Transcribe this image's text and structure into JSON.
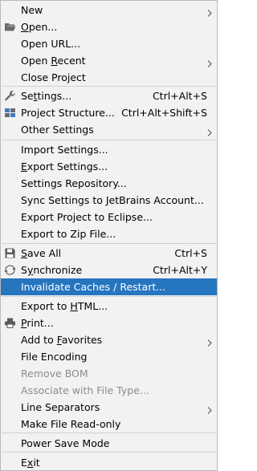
{
  "menu": {
    "items": [
      {
        "id": "new",
        "label": "New",
        "mnemonic_index": -1,
        "shortcut": "",
        "submenu": true,
        "icon": "",
        "disabled": false
      },
      {
        "id": "open",
        "label": "Open...",
        "mnemonic_index": 0,
        "shortcut": "",
        "submenu": false,
        "icon": "folder-open-icon",
        "disabled": false
      },
      {
        "id": "open-url",
        "label": "Open URL...",
        "mnemonic_index": -1,
        "shortcut": "",
        "submenu": false,
        "icon": "",
        "disabled": false
      },
      {
        "id": "open-recent",
        "label": "Open Recent",
        "mnemonic_index": 5,
        "shortcut": "",
        "submenu": true,
        "icon": "",
        "disabled": false
      },
      {
        "id": "close-project",
        "label": "Close Project",
        "mnemonic_index": -1,
        "shortcut": "",
        "submenu": false,
        "icon": "",
        "disabled": false
      },
      {
        "id": "settings",
        "label": "Settings...",
        "mnemonic_index": 2,
        "shortcut": "Ctrl+Alt+S",
        "submenu": false,
        "icon": "wrench-icon",
        "disabled": false
      },
      {
        "id": "project-structure",
        "label": "Project Structure...",
        "mnemonic_index": -1,
        "shortcut": "Ctrl+Alt+Shift+S",
        "submenu": false,
        "icon": "project-structure-icon",
        "disabled": false
      },
      {
        "id": "other-settings",
        "label": "Other Settings",
        "mnemonic_index": -1,
        "shortcut": "",
        "submenu": true,
        "icon": "",
        "disabled": false
      },
      {
        "id": "import-settings",
        "label": "Import Settings...",
        "mnemonic_index": -1,
        "shortcut": "",
        "submenu": false,
        "icon": "",
        "disabled": false
      },
      {
        "id": "export-settings",
        "label": "Export Settings...",
        "mnemonic_index": 0,
        "shortcut": "",
        "submenu": false,
        "icon": "",
        "disabled": false
      },
      {
        "id": "settings-repository",
        "label": "Settings Repository...",
        "mnemonic_index": -1,
        "shortcut": "",
        "submenu": false,
        "icon": "",
        "disabled": false
      },
      {
        "id": "sync-settings",
        "label": "Sync Settings to JetBrains Account...",
        "mnemonic_index": -1,
        "shortcut": "",
        "submenu": false,
        "icon": "",
        "disabled": false
      },
      {
        "id": "export-eclipse",
        "label": "Export Project to Eclipse...",
        "mnemonic_index": -1,
        "shortcut": "",
        "submenu": false,
        "icon": "",
        "disabled": false
      },
      {
        "id": "export-zip",
        "label": "Export to Zip File...",
        "mnemonic_index": -1,
        "shortcut": "",
        "submenu": false,
        "icon": "",
        "disabled": false
      },
      {
        "id": "save-all",
        "label": "Save All",
        "mnemonic_index": 0,
        "shortcut": "Ctrl+S",
        "submenu": false,
        "icon": "save-icon",
        "disabled": false
      },
      {
        "id": "synchronize",
        "label": "Synchronize",
        "mnemonic_index": 1,
        "shortcut": "Ctrl+Alt+Y",
        "submenu": false,
        "icon": "sync-icon",
        "disabled": false
      },
      {
        "id": "invalidate-caches",
        "label": "Invalidate Caches / Restart...",
        "mnemonic_index": -1,
        "shortcut": "",
        "submenu": false,
        "icon": "",
        "disabled": false,
        "highlighted": true
      },
      {
        "id": "export-html",
        "label": "Export to HTML...",
        "mnemonic_index": 10,
        "shortcut": "",
        "submenu": false,
        "icon": "",
        "disabled": false
      },
      {
        "id": "print",
        "label": "Print...",
        "mnemonic_index": 0,
        "shortcut": "",
        "submenu": false,
        "icon": "printer-icon",
        "disabled": false
      },
      {
        "id": "add-favorites",
        "label": "Add to Favorites",
        "mnemonic_index": 7,
        "shortcut": "",
        "submenu": true,
        "icon": "",
        "disabled": false
      },
      {
        "id": "file-encoding",
        "label": "File Encoding",
        "mnemonic_index": -1,
        "shortcut": "",
        "submenu": false,
        "icon": "",
        "disabled": false
      },
      {
        "id": "remove-bom",
        "label": "Remove BOM",
        "mnemonic_index": -1,
        "shortcut": "",
        "submenu": false,
        "icon": "",
        "disabled": true
      },
      {
        "id": "associate-file-type",
        "label": "Associate with File Type...",
        "mnemonic_index": -1,
        "shortcut": "",
        "submenu": false,
        "icon": "",
        "disabled": true
      },
      {
        "id": "line-separators",
        "label": "Line Separators",
        "mnemonic_index": -1,
        "shortcut": "",
        "submenu": true,
        "icon": "",
        "disabled": false
      },
      {
        "id": "make-read-only",
        "label": "Make File Read-only",
        "mnemonic_index": -1,
        "shortcut": "",
        "submenu": false,
        "icon": "",
        "disabled": false
      },
      {
        "id": "power-save",
        "label": "Power Save Mode",
        "mnemonic_index": -1,
        "shortcut": "",
        "submenu": false,
        "icon": "",
        "disabled": false
      },
      {
        "id": "exit",
        "label": "Exit",
        "mnemonic_index": 1,
        "shortcut": "",
        "submenu": false,
        "icon": "",
        "disabled": false
      }
    ]
  },
  "colors": {
    "background": "#f2f2f2",
    "highlight": "#2675bf",
    "highlight_text": "#ffffff",
    "disabled_text": "#8c8c8c",
    "separator": "#d1d1d1"
  }
}
